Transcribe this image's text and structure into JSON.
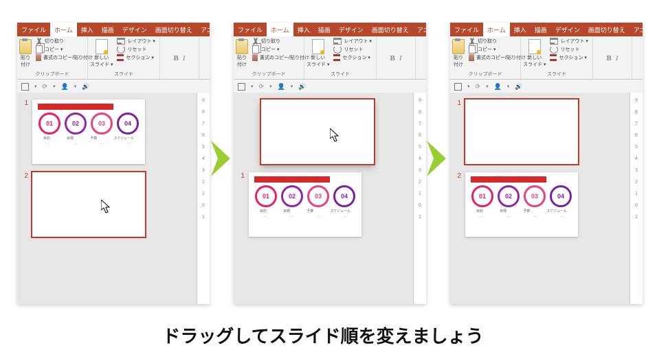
{
  "tabs": {
    "file": "ファイル",
    "home": "ホーム",
    "insert": "挿入",
    "draw": "描画",
    "design": "デザイン",
    "transition": "画面切り替え",
    "anim": "アニ"
  },
  "ribbon": {
    "paste": "貼り付け",
    "cut": "切り取り",
    "copy": "コピー ▾",
    "format_painter": "書式のコピー/貼り付け",
    "clipboard": "クリップボード",
    "new_slide": "新しい\nスライド ▾",
    "layout": "レイアウト ▾",
    "reset": "リセット",
    "section": "セクション ▾",
    "slides": "スライド",
    "bold": "B",
    "italic": "I"
  },
  "qbar": {
    "dd1": "▾",
    "dd2": "▾",
    "dd3": "▾"
  },
  "slide_content": {
    "c1": "01",
    "c2": "02",
    "c3": "03",
    "c4": "04",
    "l1": "目的",
    "l2": "目標",
    "l3": "予算",
    "l4": "スケジュール"
  },
  "panels": {
    "a": {
      "n1": "1",
      "n2": "2"
    },
    "b": {
      "n1": "1"
    },
    "c": {
      "n1": "1",
      "n2": "2"
    }
  },
  "ruler_marks": [
    "0",
    "1",
    "2",
    "3",
    "4",
    "5",
    "6",
    "7",
    "8",
    "9"
  ],
  "caption": "ドラッグしてスライド順を変えましょう"
}
